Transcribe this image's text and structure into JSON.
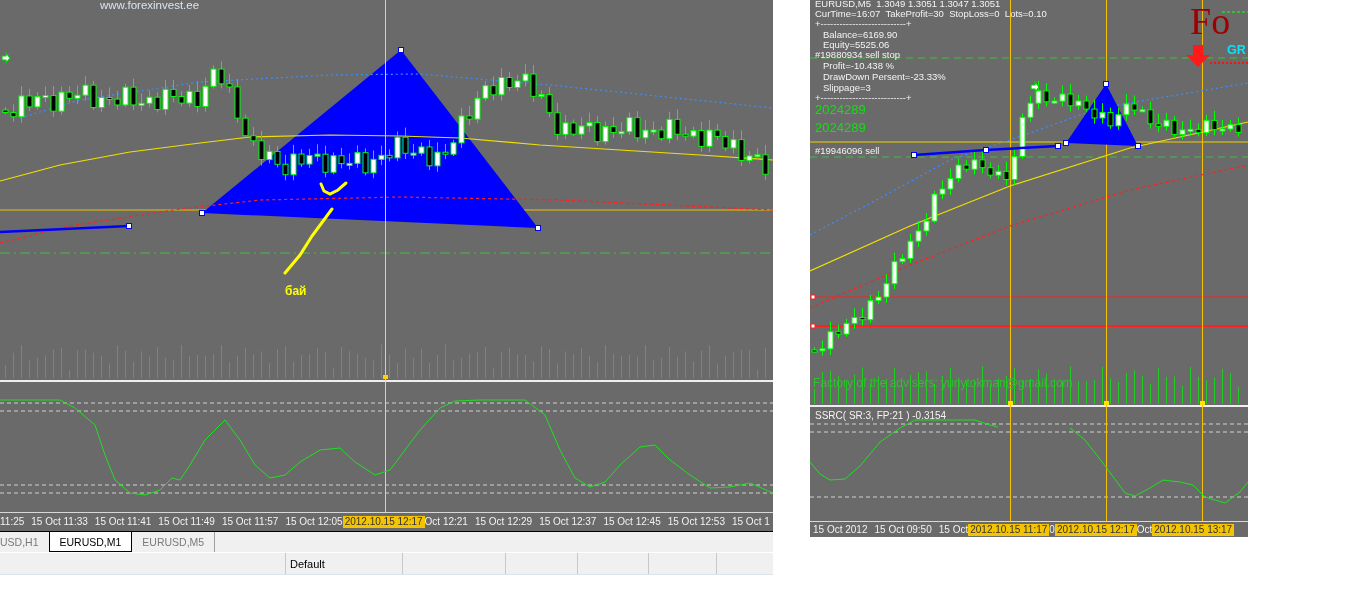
{
  "left_window": {
    "chart": {
      "site_label": "www.forexinvest.ee",
      "annotation": "бай"
    },
    "time_axis": [
      {
        "text": "11:25",
        "kind": "partial"
      },
      {
        "text": "15 Oct 11:33",
        "kind": "tick"
      },
      {
        "text": "15 Oct 11:41",
        "kind": "tick"
      },
      {
        "text": "15 Oct 11:49",
        "kind": "tick"
      },
      {
        "text": "15 Oct 11:57",
        "kind": "tick"
      },
      {
        "text": "15 Oct 12:05",
        "kind": "tick"
      },
      {
        "text": "2012.10.15 12:17",
        "kind": "cursor"
      },
      {
        "text": "Oct 12:21",
        "kind": "partial"
      },
      {
        "text": "15 Oct 12:29",
        "kind": "tick"
      },
      {
        "text": "15 Oct 12:37",
        "kind": "tick"
      },
      {
        "text": "15 Oct 12:45",
        "kind": "tick"
      },
      {
        "text": "15 Oct 12:53",
        "kind": "tick"
      },
      {
        "text": "15 Oct 1",
        "kind": "tick"
      }
    ],
    "tabs": [
      {
        "label": "USD,H1",
        "selected": false
      },
      {
        "label": "EURUSD,M1",
        "selected": true
      },
      {
        "label": "EURUSD,M5",
        "selected": false
      }
    ],
    "status_bar": {
      "profile": "Default"
    }
  },
  "right_window": {
    "symbol_line": "EURUSD,M5  1.3049 1.3051 1.3047 1.3051",
    "info_line": "CurTime=16:07  TakeProfit=30  StopLoss=0  Lots=0.10",
    "account_panel": {
      "top_rule": "+---------------------------+",
      "lines_upper": [
        "Balance=6169.90",
        "Equity=5525.06"
      ],
      "lines_lower": [
        "Profit=-10.438 %",
        "DrawDown Persent=-23.33%",
        "Slippage=3"
      ],
      "bottom_rule": "+---------------------------+"
    },
    "order_labels": [
      "#19880934 sell stop",
      "#19946096 sell"
    ],
    "counters": [
      "2024289",
      "2024289"
    ],
    "logo": {
      "text": "Fo",
      "subtext": "GR"
    },
    "footer_text": "Factory of the advisers: yuriytokman@gmail.com",
    "indicator_label": "SSRC( SR:3, FP:21 ) -0.3154",
    "time_axis": [
      {
        "text": "15 Oct 2012",
        "kind": "tick"
      },
      {
        "text": "15 Oct 09:50",
        "kind": "tick"
      },
      {
        "text": "15 Oct",
        "kind": "tick"
      },
      {
        "text": "2012.10.15 11:17",
        "kind": "cursor"
      },
      {
        "text": "0",
        "kind": "partial"
      },
      {
        "text": "2012.10.15 12:17",
        "kind": "cursor"
      },
      {
        "text": "Oct",
        "kind": "partial"
      },
      {
        "text": "2012.10.15 13:17",
        "kind": "cursor"
      }
    ]
  }
}
